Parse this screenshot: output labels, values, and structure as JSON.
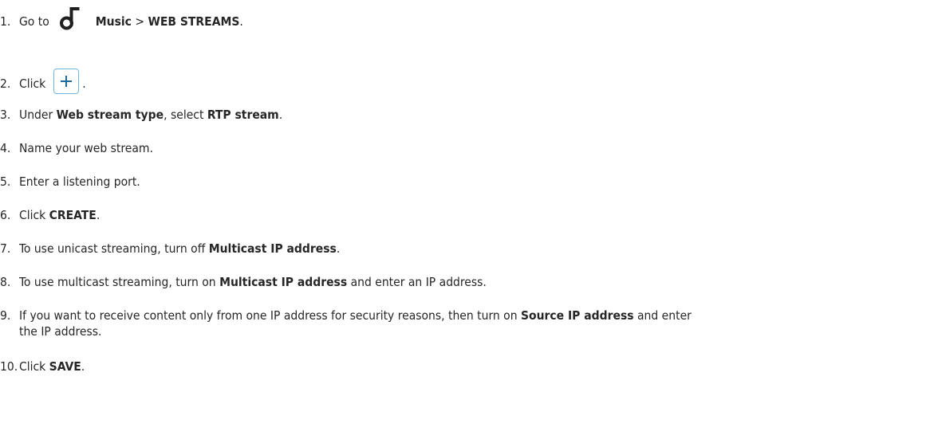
{
  "steps": [
    {
      "num": "1.",
      "parts": [
        "Go to",
        "Music",
        ">",
        "WEB STREAMS",
        "."
      ]
    },
    {
      "num": "2.",
      "parts": [
        "Click",
        "."
      ]
    },
    {
      "num": "3.",
      "parts": [
        "Under",
        "Web stream type",
        ",",
        "select",
        "RTP stream",
        "."
      ]
    },
    {
      "num": "4.",
      "parts": [
        "Name your web stream."
      ]
    },
    {
      "num": "5.",
      "parts": [
        "Enter a listening port."
      ]
    },
    {
      "num": "6.",
      "parts": [
        "Click",
        "CREATE",
        "."
      ]
    },
    {
      "num": "7.",
      "parts": [
        "To use unicast streaming, turn off",
        "Multicast IP address",
        "."
      ]
    },
    {
      "num": "8.",
      "parts": [
        "To use multicast streaming, turn on",
        "Multicast IP address",
        "and enter an IP address."
      ]
    },
    {
      "num": "9.",
      "parts": [
        "If you want to receive content only from one IP address for security reasons, then turn on",
        "Source IP address",
        "and enter",
        "the IP address."
      ]
    },
    {
      "num": "10.",
      "parts": [
        "Click",
        "SAVE",
        "."
      ]
    }
  ],
  "icons": {
    "music": "music-note-icon",
    "add": "plus-icon"
  },
  "colors": {
    "text": "#262626",
    "button_border": "#6fb8d6",
    "plus": "#1a6b9a"
  }
}
